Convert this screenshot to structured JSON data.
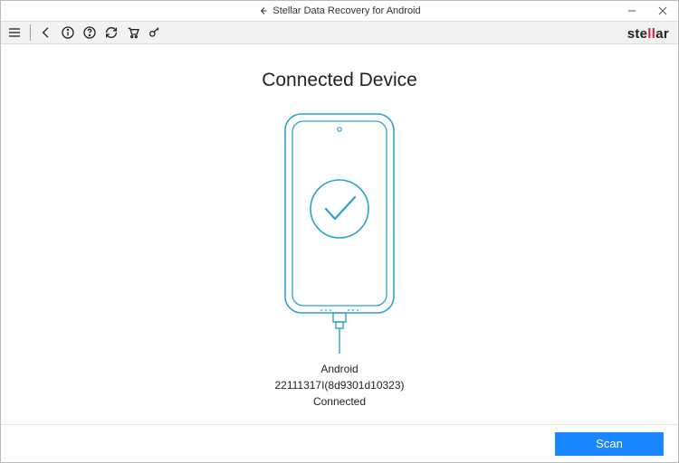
{
  "window": {
    "title": "Stellar Data Recovery for Android"
  },
  "brand": {
    "part1": "ste",
    "part2": "ll",
    "part3": "ar"
  },
  "main": {
    "heading": "Connected Device",
    "device_type": "Android",
    "device_id": "22111317I(8d9301d10323)",
    "status": "Connected"
  },
  "footer": {
    "scan_label": "Scan"
  },
  "colors": {
    "accent": "#1a86ff",
    "phone_stroke": "#2aa3c9",
    "brand_red": "#d6233b"
  }
}
